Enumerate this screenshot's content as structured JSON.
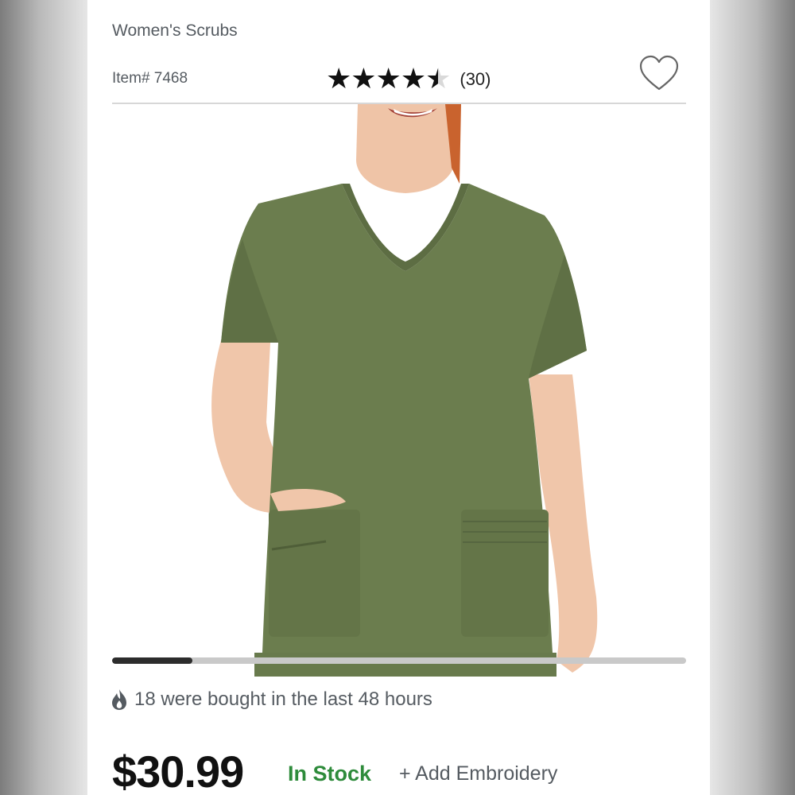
{
  "product": {
    "category": "Women's Scrubs",
    "item_number": "Item# 7468",
    "rating": 4.5,
    "rating_max": 5,
    "stars_text": "★★★★★",
    "review_count": "(30)",
    "price": "$30.99",
    "stock_status": "In Stock",
    "add_embroidery": "+ Add Embroidery"
  },
  "gallery": {
    "position_fraction": 0.14,
    "image_description": "model wearing olive green v-neck scrub top"
  },
  "social_proof": {
    "text": "18 were bought in the last 48 hours",
    "icon": "flame-icon"
  },
  "icons": {
    "favorite": "heart-outline-icon"
  },
  "colors": {
    "scrub_green": "#6b7d4e",
    "stock_green": "#2e8b3b",
    "text_gray": "#555b61"
  }
}
